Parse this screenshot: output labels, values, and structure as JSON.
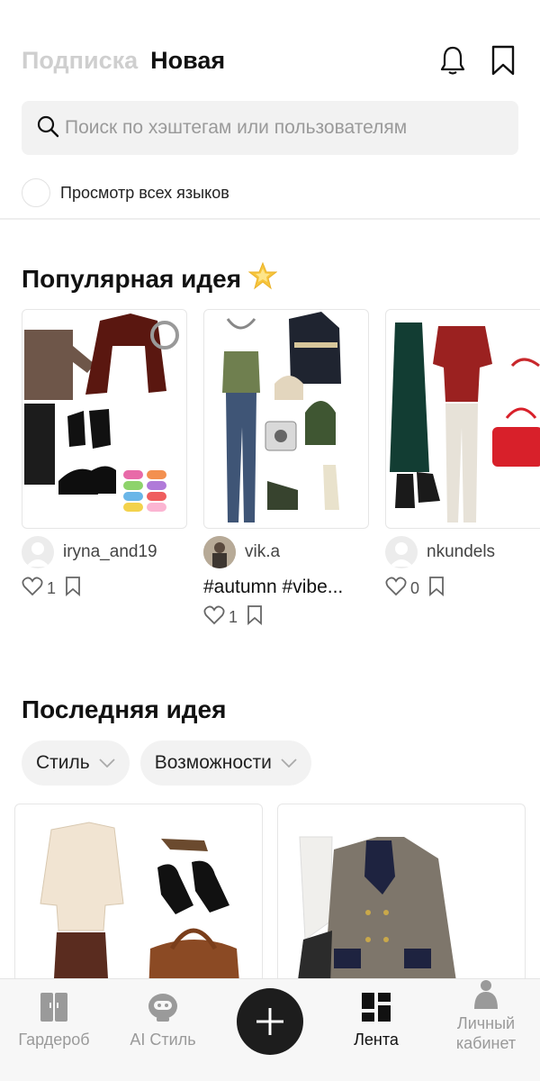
{
  "header": {
    "tabs": [
      {
        "label": "Подписка",
        "active": false
      },
      {
        "label": "Новая",
        "active": true
      }
    ],
    "icons": [
      "bell-icon",
      "bookmark-icon"
    ]
  },
  "search": {
    "placeholder": "Поиск по хэштегам или пользователям",
    "value": ""
  },
  "language_toggle": {
    "label": "Просмотр всех языков",
    "checked": false
  },
  "popular": {
    "title": "Популярная идея",
    "cards": [
      {
        "user": "iryna_and19",
        "tags": "",
        "likes": "1"
      },
      {
        "user": "vik.a",
        "tags": "#autumn  #vibe...",
        "likes": "1"
      },
      {
        "user": "nkundels",
        "tags": "",
        "likes": "0"
      }
    ]
  },
  "latest": {
    "title": "Последняя идея",
    "filters": [
      "Стиль",
      "Возможности"
    ]
  },
  "bottom_nav": {
    "items": [
      {
        "label": "Гардероб",
        "icon": "wardrobe-icon",
        "active": false
      },
      {
        "label": "AI Стиль",
        "icon": "robot-icon",
        "active": false
      },
      {
        "label": "Лента",
        "icon": "feed-icon",
        "active": true
      },
      {
        "label": "Личный кабинет",
        "icon": "profile-icon",
        "active": false
      }
    ]
  },
  "colors": {
    "accent": "#111111",
    "inactive_tab": "#cfcfcf",
    "chip_bg": "#f2f2f2",
    "fab": "#1d1d1d"
  }
}
